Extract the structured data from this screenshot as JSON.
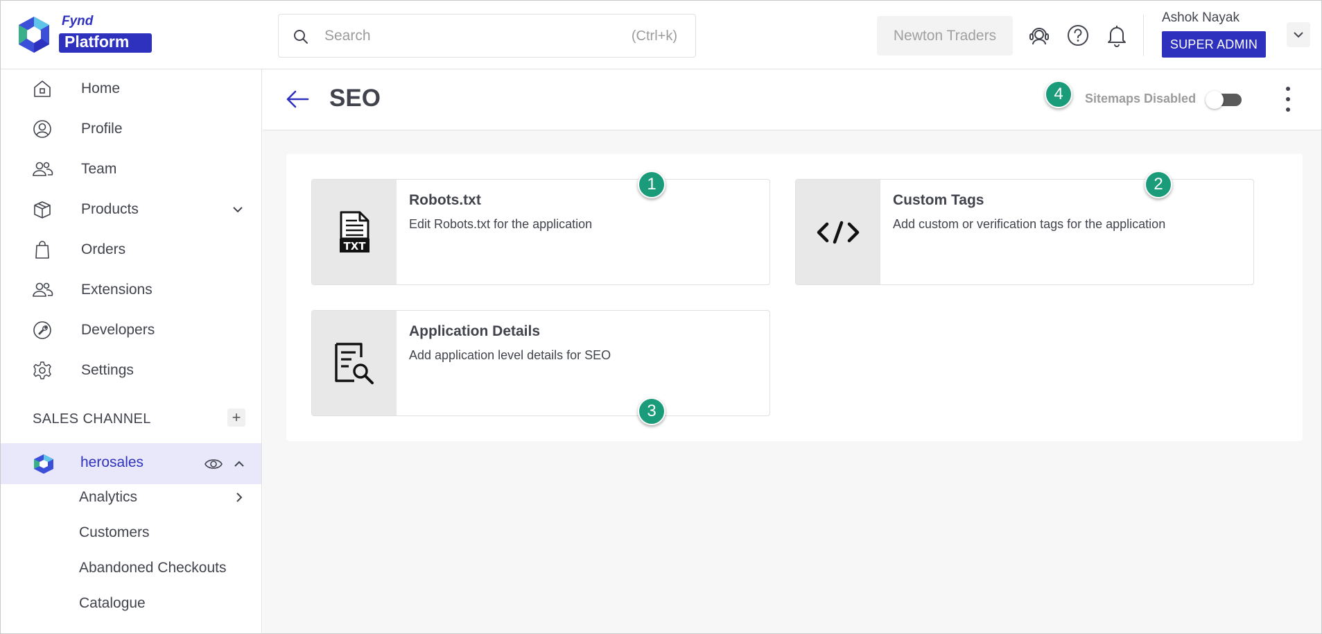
{
  "header": {
    "logo_top": "Fynd",
    "logo_bottom": "Platform",
    "search": {
      "placeholder": "Search",
      "shortcut": "(Ctrl+k)"
    },
    "company": "Newton Traders",
    "user": {
      "name": "Ashok Nayak",
      "role": "SUPER ADMIN"
    }
  },
  "sidebar": {
    "items": [
      {
        "label": "Home",
        "icon": "home-icon"
      },
      {
        "label": "Profile",
        "icon": "profile-icon"
      },
      {
        "label": "Team",
        "icon": "team-icon"
      },
      {
        "label": "Products",
        "icon": "box-icon"
      },
      {
        "label": "Orders",
        "icon": "bag-icon"
      },
      {
        "label": "Extensions",
        "icon": "extensions-icon"
      },
      {
        "label": "Developers",
        "icon": "wrench-icon"
      },
      {
        "label": "Settings",
        "icon": "gear-icon"
      }
    ],
    "section_label": "SALES CHANNEL",
    "add_label": "+",
    "channel": {
      "name": "herosales"
    },
    "sub_items": [
      {
        "label": "Analytics"
      },
      {
        "label": "Customers"
      },
      {
        "label": "Abandoned Checkouts"
      },
      {
        "label": "Catalogue"
      }
    ]
  },
  "main": {
    "title": "SEO",
    "sitemap_label": "Sitemaps Disabled",
    "sitemap_enabled": false,
    "cards": [
      {
        "title": "Robots.txt",
        "description": "Edit Robots.txt for the application",
        "icon": "txt-file-icon"
      },
      {
        "title": "Custom Tags",
        "description": "Add custom or verification tags for the application",
        "icon": "code-icon"
      },
      {
        "title": "Application Details",
        "description": "Add application level details for SEO",
        "icon": "document-search-icon"
      }
    ]
  },
  "markers": [
    "1",
    "2",
    "3",
    "4"
  ],
  "colors": {
    "accent": "#2e31be",
    "marker": "#1a9b7a",
    "active_bg": "#e8e8fa"
  }
}
